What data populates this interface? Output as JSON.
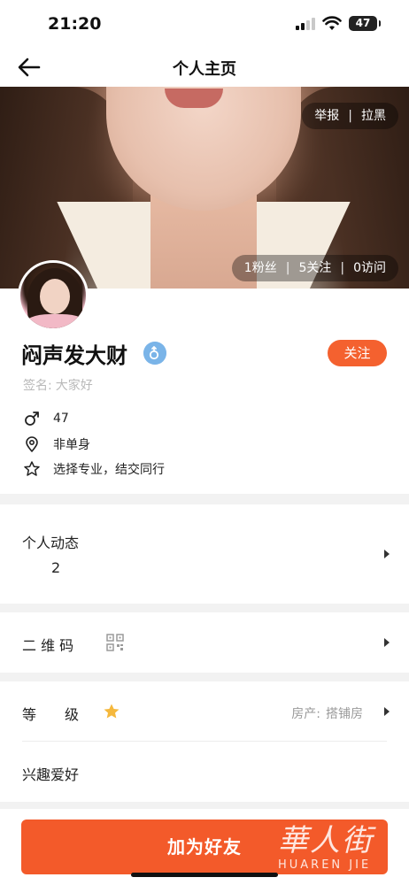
{
  "status_bar": {
    "time": "21:20",
    "battery": "47"
  },
  "nav": {
    "title": "个人主页"
  },
  "cover": {
    "report": "举报",
    "block": "拉黑",
    "divider": "|",
    "stats": {
      "fans": "1粉丝",
      "follows": "5关注",
      "visits": "0访问"
    }
  },
  "profile": {
    "name": "闷声发大财",
    "follow_label": "关注",
    "signature_prefix": "签名:",
    "signature": "大家好",
    "age": "47",
    "relationship": "非单身",
    "tagline": "选择专业，结交同行"
  },
  "sections": {
    "moments_label": "个人动态",
    "moments_count": "2",
    "qr_label": "二 维 码",
    "level_label": "等　　级",
    "property_label": "房产:",
    "property_value": "搭铺房",
    "hobbies_label": "兴趣爱好"
  },
  "action": {
    "add_friend": "加为好友"
  },
  "watermark": {
    "cn": "華人街",
    "en": "HUAREN JIE"
  },
  "colors": {
    "accent": "#f4612f",
    "male_blue": "#7ab4e8",
    "star": "#f5b83d"
  }
}
